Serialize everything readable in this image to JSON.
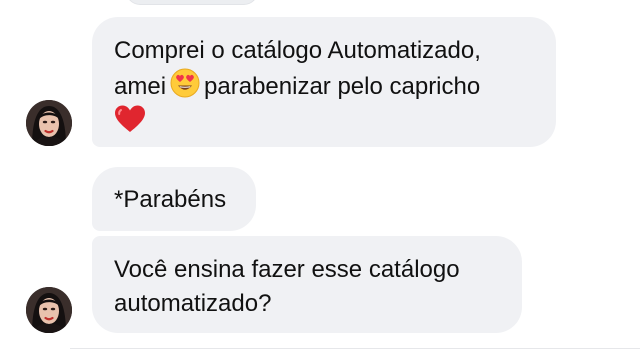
{
  "chat": {
    "messages": [
      {
        "line1": "Comprei o catálogo Automatizado,",
        "line2_before": "amei",
        "line2_emoji": "smiling-face-heart-eyes-emoji",
        "line2_after": "parabenizar pelo capricho",
        "line3_emoji": "red-heart-emoji"
      },
      {
        "text": "*Parabéns"
      },
      {
        "line1": "Você ensina fazer esse catálogo",
        "line2": "automatizado?"
      }
    ],
    "colors": {
      "bubble_background": "#f0f1f4",
      "text": "#111111",
      "heart": "#e0262f"
    }
  }
}
